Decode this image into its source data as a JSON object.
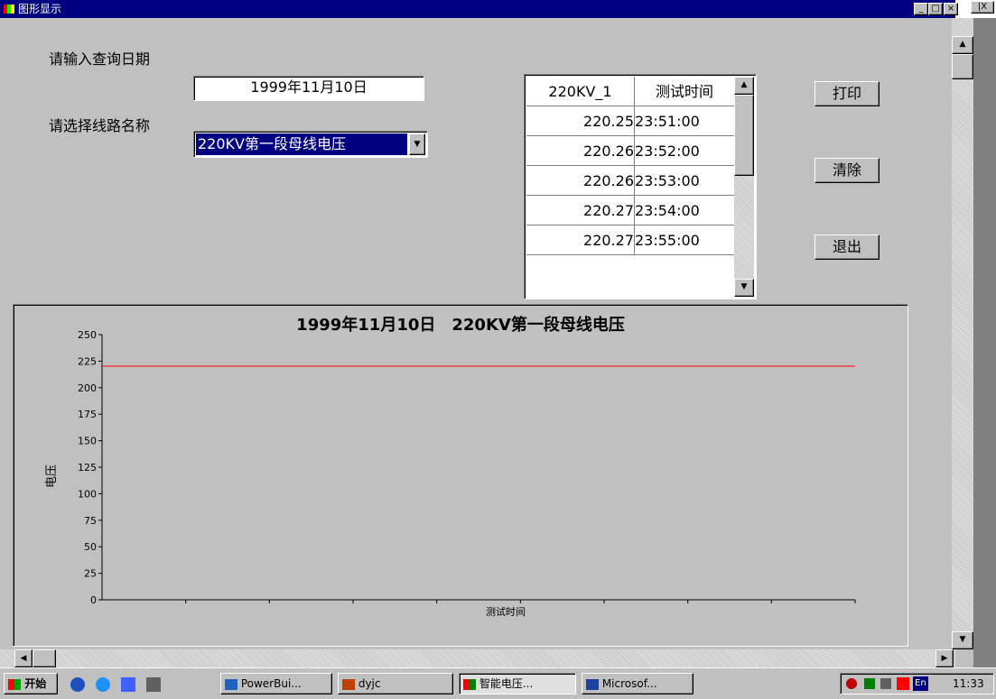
{
  "window": {
    "title": "图形显示",
    "min_btn": "_",
    "max_btn": "□",
    "close_btn": "×",
    "outer_partial_btn": "|X"
  },
  "form": {
    "date_label": "请输入查询日期",
    "date_value": "1999年11月10日",
    "line_label": "请选择线路名称",
    "line_value": "220KV第一段母线电压"
  },
  "grid": {
    "columns": [
      "220KV_1",
      "测试时间"
    ],
    "rows": [
      [
        "220.25",
        "23:51:00"
      ],
      [
        "220.26",
        "23:52:00"
      ],
      [
        "220.26",
        "23:53:00"
      ],
      [
        "220.27",
        "23:54:00"
      ],
      [
        "220.27",
        "23:55:00"
      ]
    ]
  },
  "buttons": {
    "print": "打印",
    "clear": "清除",
    "exit": "退出"
  },
  "chart_data": {
    "type": "line",
    "title": "1999年11月10日　220KV第一段母线电压",
    "xlabel": "测试时间",
    "ylabel": "电压",
    "yticks": [
      0,
      25,
      50,
      75,
      100,
      125,
      150,
      175,
      200,
      225,
      250
    ],
    "ylim": [
      0,
      250
    ],
    "x_tick_count": 9,
    "series": [
      {
        "values": [
          220.25,
          220.26,
          220.26,
          220.27,
          220.27
        ],
        "color": "#ff0000"
      }
    ],
    "grid": false
  },
  "taskbar": {
    "start": "开始",
    "tasks": [
      "PowerBui...",
      "dyjc",
      "智能电压...",
      "Microsof..."
    ],
    "tray_en": "En",
    "clock": "11:33"
  },
  "colors": {
    "title_bar": "#000080",
    "face": "#c0c0c0",
    "series": "#ff0000"
  }
}
